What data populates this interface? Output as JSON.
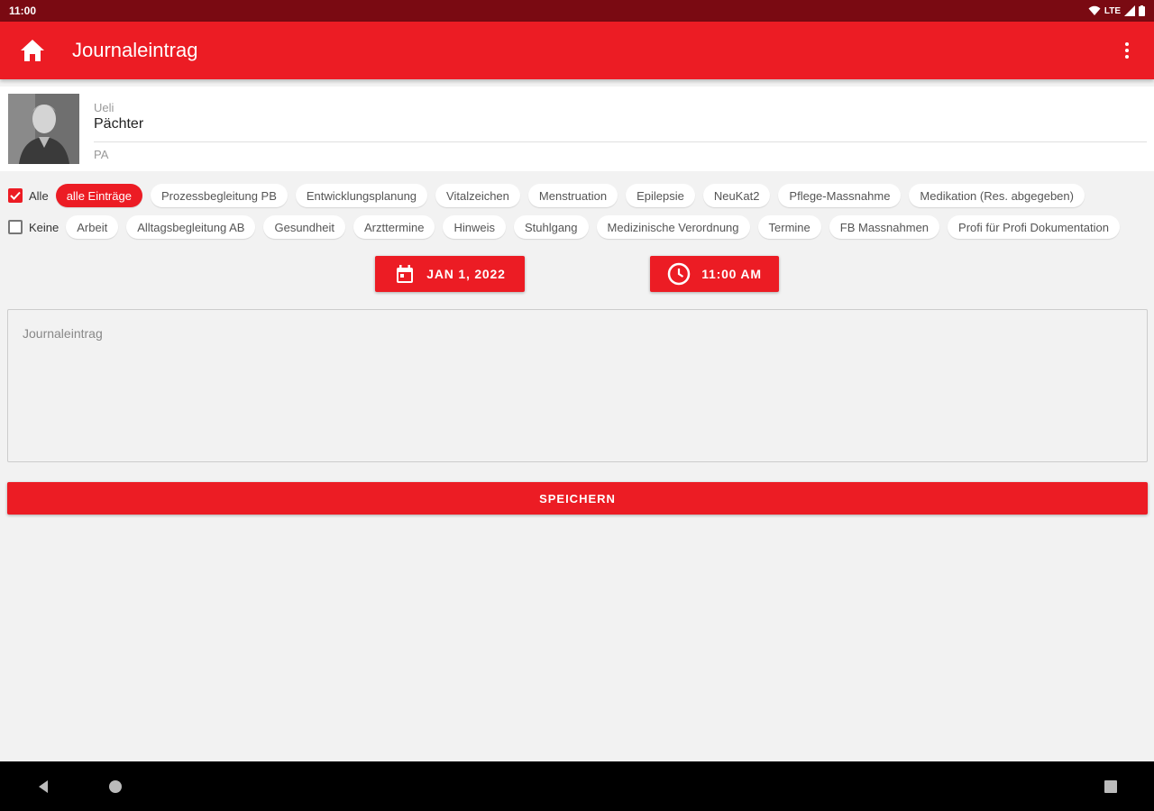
{
  "status_bar": {
    "time": "11:00",
    "network": "LTE"
  },
  "app_bar": {
    "title": "Journaleintrag",
    "home_icon": "home-icon",
    "menu_icon": "more-vert-icon"
  },
  "profile": {
    "first_name": "Ueli",
    "last_name": "Pächter",
    "abbreviation": "PA"
  },
  "filters": {
    "row1": {
      "checkbox_label": "Alle",
      "checked": true,
      "chips": [
        "alle Einträge",
        "Prozessbegleitung PB",
        "Entwicklungsplanung",
        "Vitalzeichen",
        "Menstruation",
        "Epilepsie",
        "NeuKat2",
        "Pflege-Massnahme",
        "Medikation (Res. abgegeben)"
      ],
      "selected": "alle Einträge"
    },
    "row2": {
      "checkbox_label": "Keine",
      "checked": false,
      "chips": [
        "Arbeit",
        "Alltagsbegleitung AB",
        "Gesundheit",
        "Arzttermine",
        "Hinweis",
        "Stuhlgang",
        "Medizinische Verordnung",
        "Termine",
        "FB Massnahmen",
        "Profi für Profi Dokumentation"
      ]
    }
  },
  "datetime": {
    "date": "JAN 1, 2022",
    "time": "11:00 AM"
  },
  "entry": {
    "placeholder": "Journaleintrag",
    "value": ""
  },
  "actions": {
    "save_label": "SPEICHERN"
  },
  "colors": {
    "primary": "#ec1c24",
    "status_bar": "#7a0a12",
    "background": "#f2f2f2"
  }
}
